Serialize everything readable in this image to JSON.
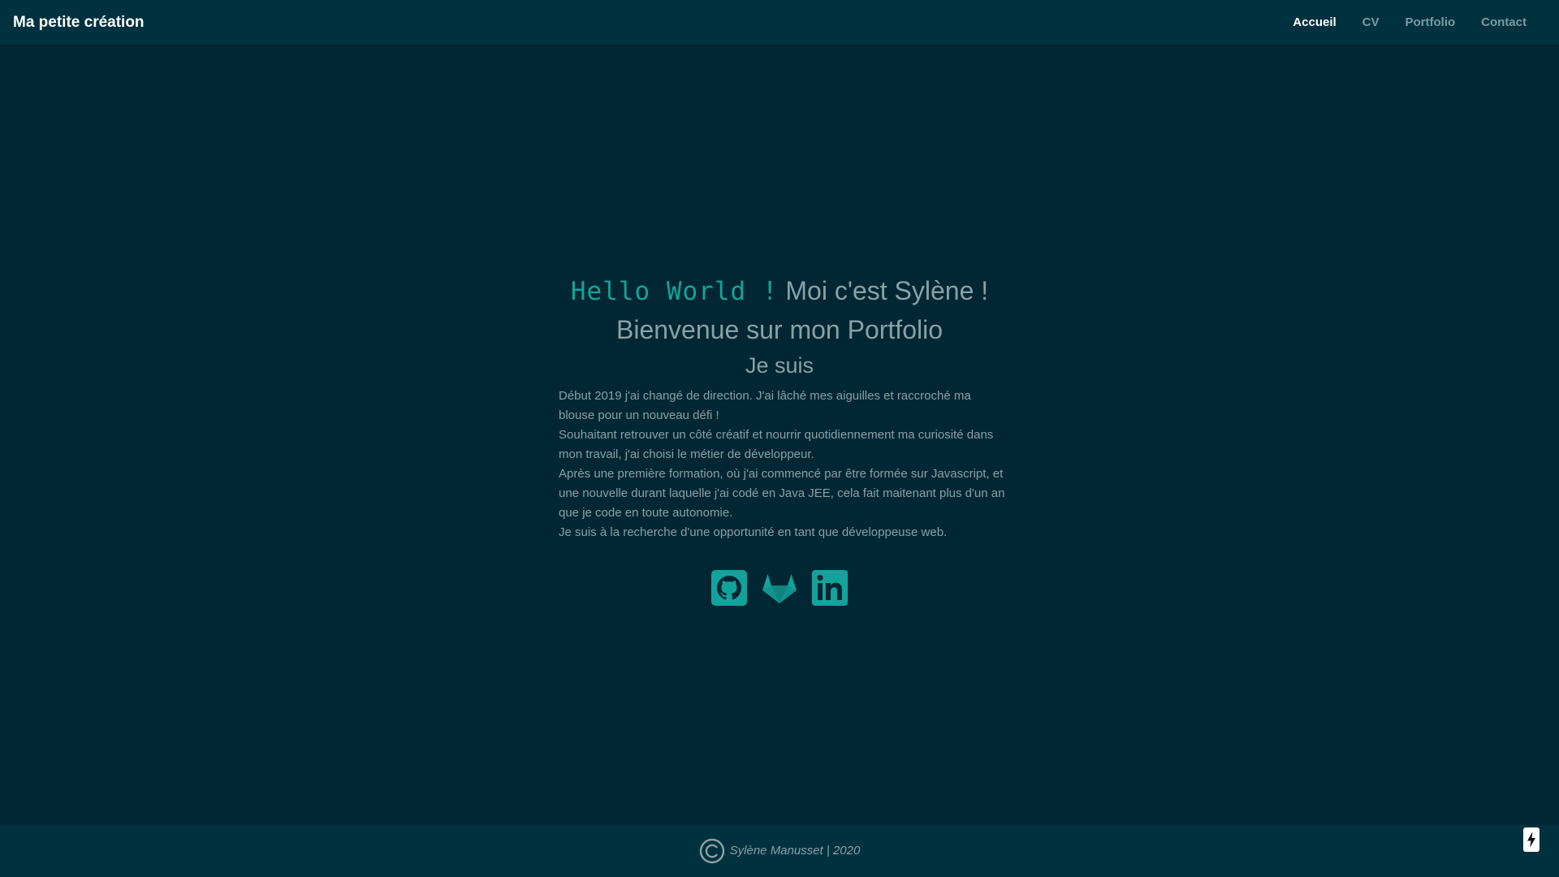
{
  "brand": "Ma petite création",
  "nav": {
    "items": [
      {
        "label": "Accueil",
        "active": true
      },
      {
        "label": "CV",
        "active": false
      },
      {
        "label": "Portfolio",
        "active": false
      },
      {
        "label": "Contact",
        "active": false
      }
    ]
  },
  "hero": {
    "hello": "Hello World !",
    "intro": "Moi c'est Sylène !",
    "welcome": "Bienvenue sur mon Portfolio",
    "je_suis": "Je suis"
  },
  "bio": {
    "lines": [
      "Début 2019 j'ai changé de direction. J'ai lâché mes aiguilles et raccroché ma blouse pour un nouveau défi !",
      "Souhaitant retrouver un côté créatif et nourrir quotidiennement ma curiosité dans mon travail, j'ai choisi le métier de développeur.",
      "Après une première formation, où j'ai commencé par être formée sur Javascript, et une nouvelle durant laquelle j'ai codé en Java JEE, cela fait maitenant plus d'un an que je code en toute autonomie.",
      "Je suis à la recherche d'une opportunité en tant que développeuse web."
    ]
  },
  "socials": [
    {
      "icon": "github-icon"
    },
    {
      "icon": "gitlab-icon"
    },
    {
      "icon": "linkedin-icon"
    }
  ],
  "footer": {
    "text": "Sylène Manusset | 2020",
    "icon": "copyright-icon"
  },
  "colors": {
    "background": "#002733",
    "navbar": "#00313f",
    "accent": "#14a39a",
    "text": "#8aa0a8",
    "nav_inactive": "#7a9aa5",
    "nav_active": "#ffffff"
  }
}
